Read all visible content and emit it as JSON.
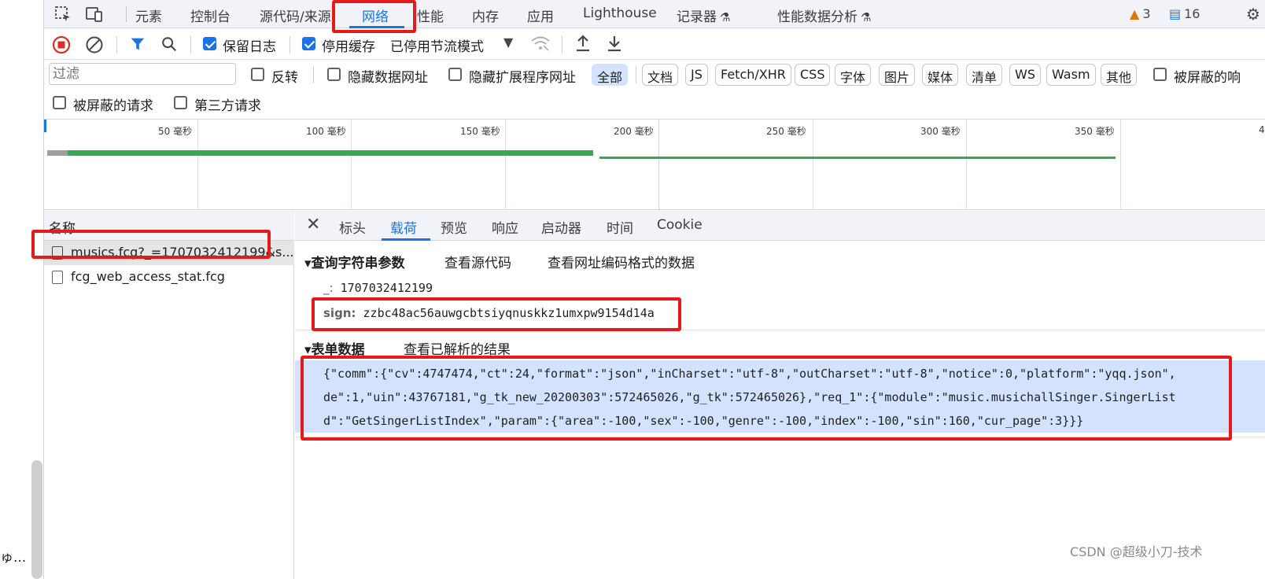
{
  "left_page": {
    "truncated_text": "ゅ..."
  },
  "tabs": {
    "items": [
      "元素",
      "控制台",
      "源代码/来源",
      "网络",
      "性能",
      "内存",
      "应用",
      "Lighthouse",
      "记录器",
      "性能数据分析"
    ],
    "warnings_count": "3",
    "messages_count": "16"
  },
  "toolbar": {
    "preserve_log": "保留日志",
    "disable_cache": "停用缓存",
    "throttle": "已停用节流模式"
  },
  "filter": {
    "placeholder": "过滤",
    "invert": "反转",
    "hide_data_urls": "隐藏数据网址",
    "hide_ext_urls": "隐藏扩展程序网址",
    "chips": [
      "全部",
      "文档",
      "JS",
      "Fetch/XHR",
      "CSS",
      "字体",
      "图片",
      "媒体",
      "清单",
      "WS",
      "Wasm",
      "其他"
    ],
    "blocked_cookies_truncated": "被屏蔽的响",
    "blocked_requests": "被屏蔽的请求",
    "third_party": "第三方请求"
  },
  "timeline": {
    "ticks": [
      "50 毫秒",
      "100 毫秒",
      "150 毫秒",
      "200 毫秒",
      "250 毫秒",
      "300 毫秒",
      "350 毫秒",
      "4"
    ]
  },
  "requests": {
    "header": "名称",
    "rows": [
      "musics.fcg?_=1707032412199&s...",
      "fcg_web_access_stat.fcg"
    ]
  },
  "detail": {
    "tabs": [
      "标头",
      "载荷",
      "预览",
      "响应",
      "启动器",
      "时间",
      "Cookie"
    ],
    "query_section": "▾查询字符串参数",
    "view_source": "查看源代码",
    "view_url_encoded": "查看网址编码格式的数据",
    "param1_key": "_:",
    "param1_value": "1707032412199",
    "param2_key": "sign:",
    "param2_value": "zzbc48ac56auwgcbtsiyqnuskkz1umxpw9154d14a",
    "form_section": "▾表单数据",
    "view_parsed": "查看已解析的结果",
    "form_lines": [
      "{\"comm\":{\"cv\":4747474,\"ct\":24,\"format\":\"json\",\"inCharset\":\"utf-8\",\"outCharset\":\"utf-8\",\"notice\":0,\"platform\":\"yqq.json\",",
      "de\":1,\"uin\":43767181,\"g_tk_new_20200303\":572465026,\"g_tk\":572465026},\"req_1\":{\"module\":\"music.musichallSinger.SingerList",
      "d\":\"GetSingerListIndex\",\"param\":{\"area\":-100,\"sex\":-100,\"genre\":-100,\"index\":-100,\"sin\":160,\"cur_page\":3}}}"
    ]
  },
  "watermark": "CSDN @超级小刀-技术",
  "colors": {
    "accent": "#1a73e8",
    "highlight": "#e31b1b",
    "selection": "#d3e3fd"
  }
}
